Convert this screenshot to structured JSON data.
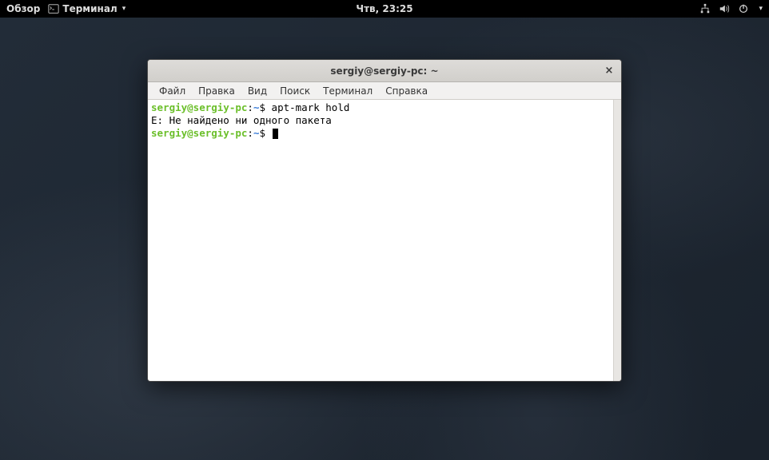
{
  "topbar": {
    "overview": "Обзор",
    "app_name": "Терминал",
    "clock": "Чтв, 23:25"
  },
  "window": {
    "title": "sergiy@sergiy-pc: ~",
    "close_symbol": "×"
  },
  "menu": {
    "file": "Файл",
    "edit": "Правка",
    "view": "Вид",
    "search": "Поиск",
    "terminal": "Терминал",
    "help": "Справка"
  },
  "terminal": {
    "prompt_user": "sergiy@sergiy-pc",
    "prompt_sep": ":",
    "prompt_path": "~",
    "prompt_sym": "$",
    "line1_cmd": "apt-mark hold",
    "line2": "E: Не найдено ни одного пакета"
  }
}
